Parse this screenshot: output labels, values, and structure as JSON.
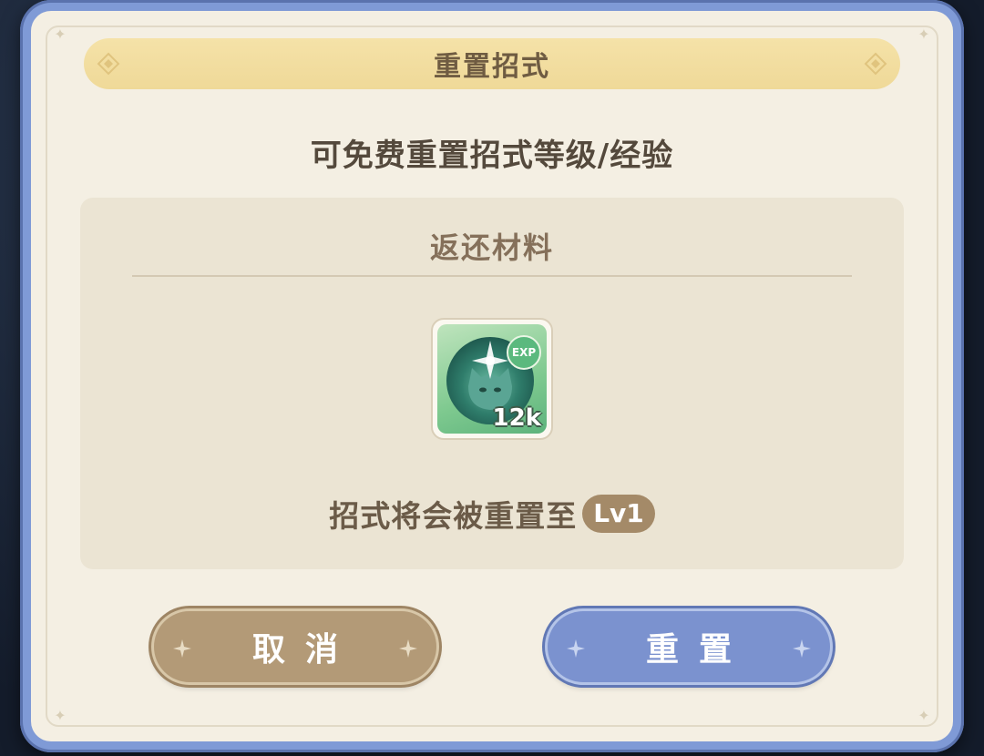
{
  "dialog": {
    "title": "重置招式",
    "subtitle": "可免费重置招式等级/经验",
    "materials_heading": "返还材料",
    "item": {
      "icon": "exp-cat-token-icon",
      "badge": "EXP",
      "count": "12k"
    },
    "reset_note": "招式将会被重置至",
    "level_badge": "Lv1",
    "buttons": {
      "cancel": "取消",
      "confirm": "重置"
    }
  },
  "colors": {
    "frame_blue": "#7f9ad6",
    "panel_bg": "#f4efe3",
    "title_bar": "#f2dd9f",
    "cancel_button": "#b39a77",
    "confirm_button": "#7b92cf",
    "level_badge": "#a48a68"
  }
}
